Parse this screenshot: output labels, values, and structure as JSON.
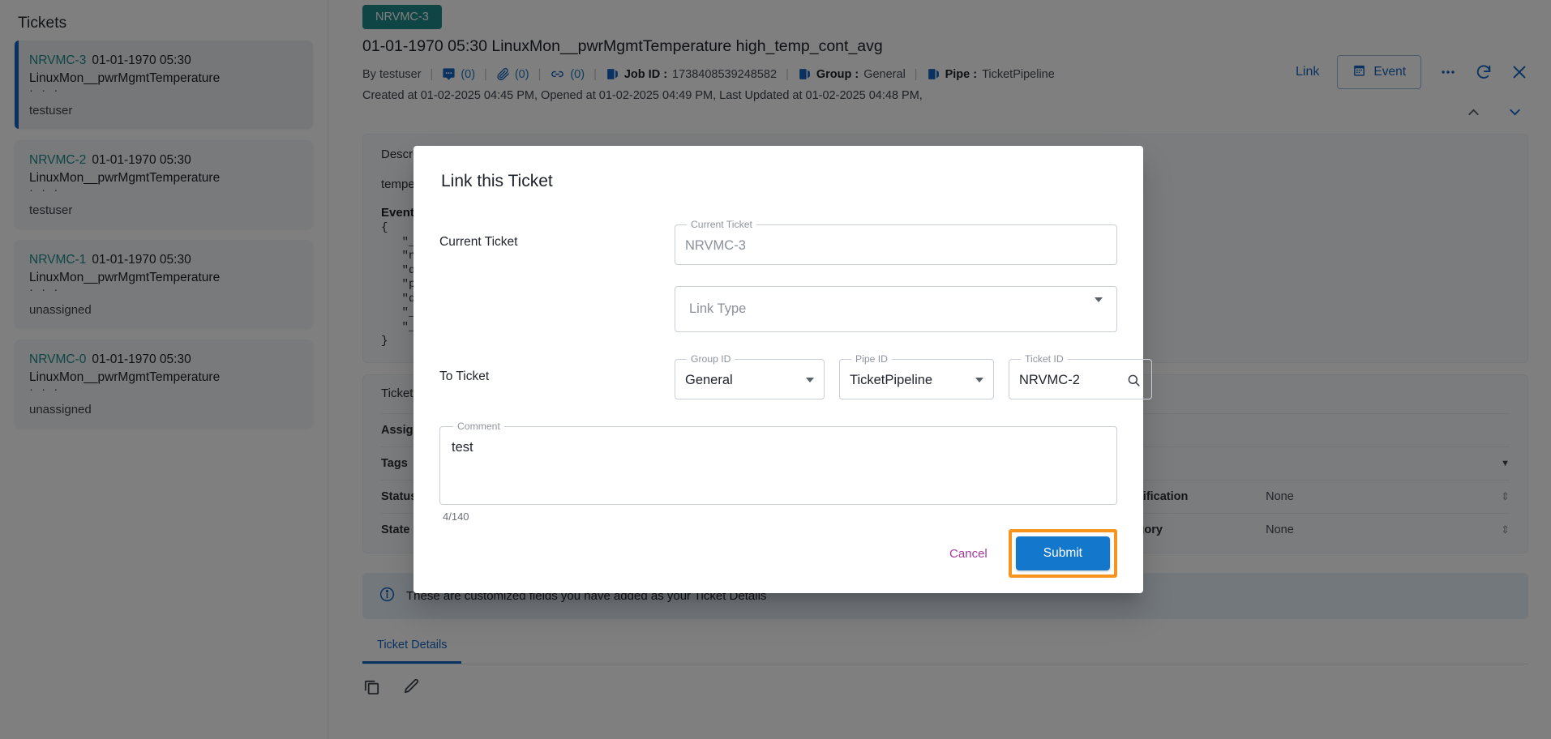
{
  "sidebar": {
    "title": "Tickets",
    "tickets": [
      {
        "id": "NRVMC-3",
        "timestamp": "01-01-1970 05:30",
        "source": "LinuxMon__pwrMgmtTemperature",
        "ellipsis": "· · ·",
        "user": "testuser",
        "selected": true
      },
      {
        "id": "NRVMC-2",
        "timestamp": "01-01-1970 05:30",
        "source": "LinuxMon__pwrMgmtTemperature",
        "ellipsis": "· · ·",
        "user": "testuser",
        "selected": false
      },
      {
        "id": "NRVMC-1",
        "timestamp": "01-01-1970 05:30",
        "source": "LinuxMon__pwrMgmtTemperature",
        "ellipsis": "· · ·",
        "user": "unassigned",
        "selected": false
      },
      {
        "id": "NRVMC-0",
        "timestamp": "01-01-1970 05:30",
        "source": "LinuxMon__pwrMgmtTemperature",
        "ellipsis": "· · ·",
        "user": "unassigned",
        "selected": false
      }
    ]
  },
  "header": {
    "badge": "NRVMC-3",
    "title": "01-01-1970 05:30 LinuxMon__pwrMgmtTemperature high_temp_cont_avg",
    "by": "By testuser",
    "comment_count": "(0)",
    "attachment_count": "(0)",
    "link_count": "(0)",
    "job_id_label": "Job ID :",
    "job_id_value": "1738408539248582",
    "group_label": "Group :",
    "group_value": "General",
    "pipe_label": "Pipe :",
    "pipe_value": "TicketPipeline",
    "dates": "Created at 01-02-2025 04:45 PM,  Opened at 01-02-2025 04:49 PM,  Last Updated at 01-02-2025 04:48 PM,",
    "link_action": "Link",
    "event_action": "Event",
    "separator": "|"
  },
  "description_panel": {
    "label": "Description",
    "text": "temperature",
    "event_label": "Event th",
    "json_lines": "{\n   \"_id\n   \"num\n   \"deg\n   \"per\n   \"dev\n   \"_pk\n   \"_jp\n}"
  },
  "ticket_info": {
    "title": "Ticket Info",
    "rows": [
      {
        "key": "Assignee",
        "value": ""
      },
      {
        "key": "Tags",
        "value": ""
      },
      {
        "key": "Status",
        "value": "",
        "key2": "Classification",
        "value2": "None"
      },
      {
        "key": "State",
        "value": "",
        "key2": "Category",
        "value2": "None"
      }
    ]
  },
  "infobar": {
    "text": "These are customized fields you have added as your Ticket Details"
  },
  "tabs": [
    {
      "label": "Ticket Details",
      "active": true
    }
  ],
  "modal": {
    "title": "Link this Ticket",
    "rows": {
      "current_ticket_label": "Current Ticket",
      "to_ticket_label": "To Ticket"
    },
    "fields": {
      "current_ticket": {
        "legend": "Current Ticket",
        "value": "NRVMC-3",
        "is_placeholder": true
      },
      "link_type": {
        "placeholder": "Link Type",
        "value": ""
      },
      "group_id": {
        "legend": "Group ID",
        "value": "General"
      },
      "pipe_id": {
        "legend": "Pipe ID",
        "value": "TicketPipeline"
      },
      "ticket_id": {
        "legend": "Ticket ID",
        "value": "NRVMC-2"
      },
      "comment": {
        "legend": "Comment",
        "value": "test",
        "counter": "4/140"
      }
    },
    "buttons": {
      "cancel": "Cancel",
      "submit": "Submit"
    }
  },
  "colors": {
    "accent_blue": "#1565c0",
    "submit_blue": "#1377cb",
    "highlight_orange": "#f7941e",
    "cancel_purple": "#a5389e",
    "badge_teal": "#1f8a8a",
    "ticket_id_teal": "#1f8a8a"
  }
}
